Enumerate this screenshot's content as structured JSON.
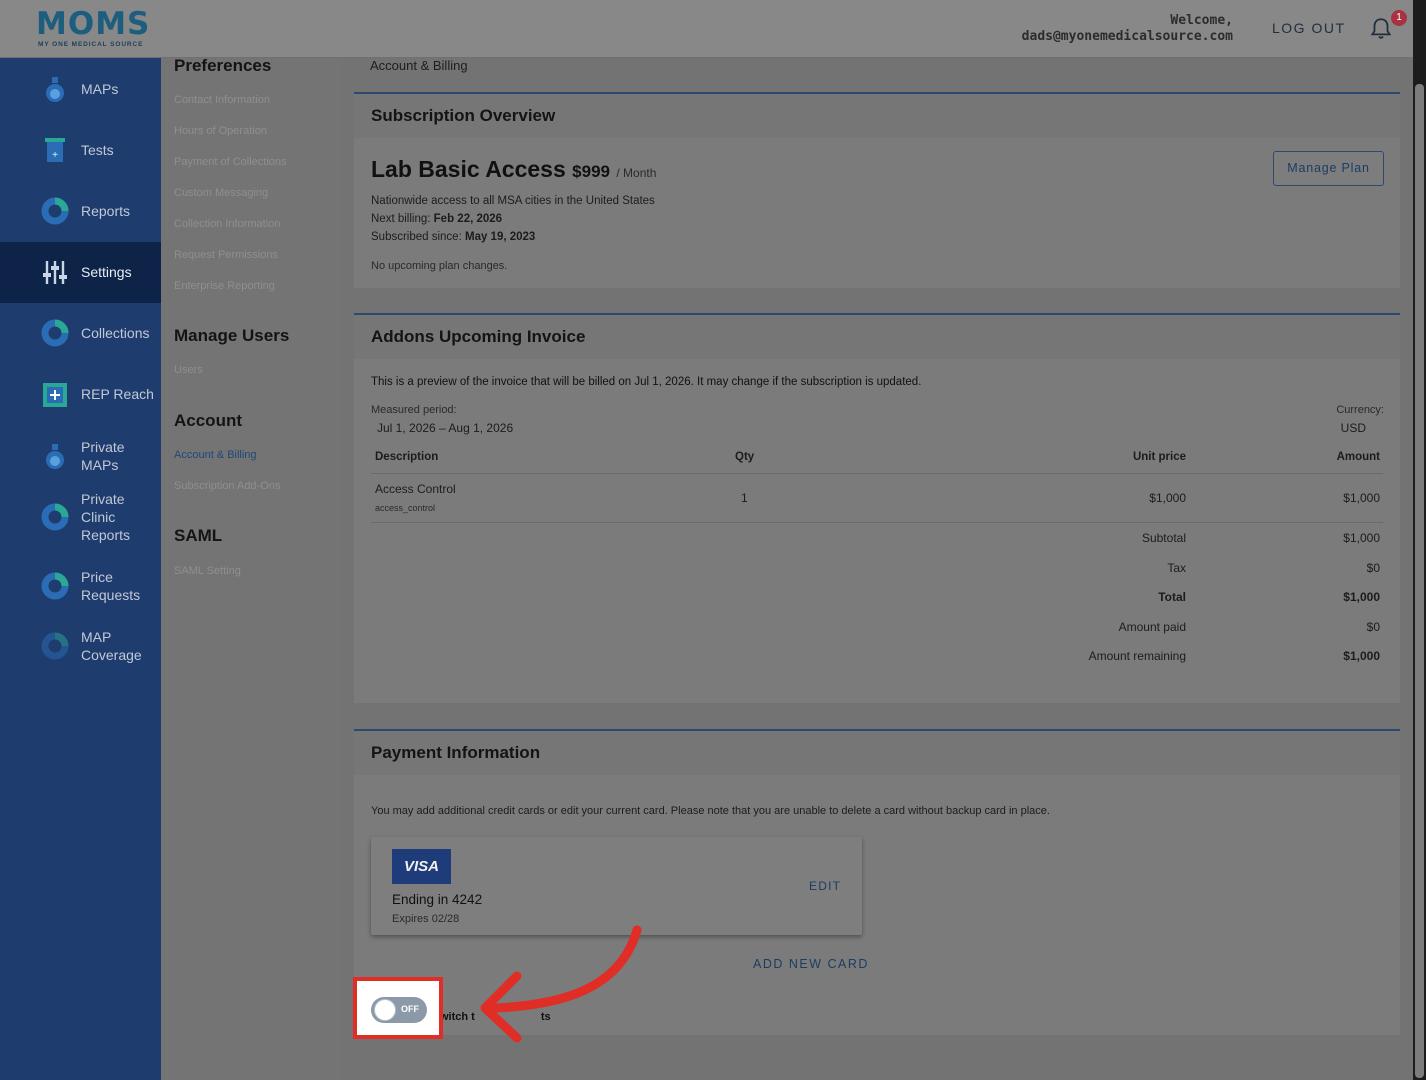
{
  "header": {
    "logo_text": "MOMS",
    "logo_tagline": "MY ONE MEDICAL SOURCE",
    "welcome": "Welcome,",
    "email": "dads@myonemedicalsource.com",
    "logout": "LOG OUT",
    "notification_count": "1"
  },
  "sidebar": {
    "items": [
      {
        "label": "MAPs",
        "icon": "flask-icon"
      },
      {
        "label": "Tests",
        "icon": "test-tube-icon"
      },
      {
        "label": "Reports",
        "icon": "donut-chart-icon"
      },
      {
        "label": "Settings",
        "icon": "sliders-icon",
        "active": true
      },
      {
        "label": "Collections",
        "icon": "donut-chart-icon"
      },
      {
        "label": "REP Reach",
        "icon": "plus-square-icon"
      },
      {
        "label": "Private MAPs",
        "icon": "flask-icon"
      },
      {
        "label": "Private Clinic Reports",
        "icon": "donut-chart-icon"
      },
      {
        "label": "Price Requests",
        "icon": "donut-chart-icon"
      },
      {
        "label": "MAP Coverage",
        "icon": "donut-chart-icon"
      }
    ]
  },
  "subnav": {
    "preferences": {
      "heading": "Preferences",
      "links": [
        "Contact Information",
        "Hours of Operation",
        "Payment of Collections",
        "Custom Messaging",
        "Collection Information",
        "Request Permissions",
        "Enterprise Reporting"
      ]
    },
    "manage_users": {
      "heading": "Manage Users",
      "links": [
        "Users"
      ]
    },
    "account": {
      "heading": "Account",
      "links": [
        "Account & Billing",
        "Subscription Add-Ons"
      ]
    },
    "saml": {
      "heading": "SAML",
      "links": [
        "SAML Setting"
      ]
    }
  },
  "main": {
    "breadcrumb": "Account & Billing",
    "subscription": {
      "title": "Subscription Overview",
      "plan_name": "Lab Basic Access",
      "price": "$999",
      "per": "/ Month",
      "description": "Nationwide access to all MSA cities in the United States",
      "next_billing_label": "Next billing:",
      "next_billing": "Feb 22, 2026",
      "subscribed_label": "Subscribed since:",
      "subscribed": "May 19, 2023",
      "note": "No upcoming plan changes.",
      "manage_button": "Manage Plan"
    },
    "invoice": {
      "title": "Addons Upcoming Invoice",
      "preview": "This is a preview of the invoice that will be billed on Jul 1, 2026. It may change if the subscription is updated.",
      "period_label": "Measured period:",
      "period": "Jul 1, 2026 – Aug 1, 2026",
      "currency_label": "Currency:",
      "currency": "USD",
      "columns": [
        "Description",
        "Qty",
        "Unit price",
        "Amount"
      ],
      "line": {
        "description": "Access Control",
        "code": "access_control",
        "qty": "1",
        "unit_price": "$1,000",
        "amount": "$1,000"
      },
      "totals": [
        {
          "label": "Subtotal",
          "value": "$1,000",
          "bold": false
        },
        {
          "label": "Tax",
          "value": "$0",
          "bold": false
        },
        {
          "label": "Total",
          "value": "$1,000",
          "bold": true
        },
        {
          "label": "Amount paid",
          "value": "$0",
          "bold": false
        },
        {
          "label": "Amount remaining",
          "value": "$1,000",
          "bold": true
        }
      ]
    },
    "payment": {
      "title": "Payment Information",
      "note": "You may add additional credit cards or edit your current card. Please note that you are unable to delete a card without backup card in place.",
      "card_brand": "VISA",
      "card_ending": "Ending in 4242",
      "card_expires": "Expires 02/28",
      "edit": "EDIT",
      "add_card": "ADD NEW CARD",
      "toggle_state": "OFF",
      "switch_label": "witch t",
      "switch_label_tail": "ts"
    }
  },
  "colors": {
    "sidebar": "#1e3c6e",
    "sidebar_active": "#0d2448",
    "accent": "#1d3c62",
    "highlight": "#e02d26"
  }
}
